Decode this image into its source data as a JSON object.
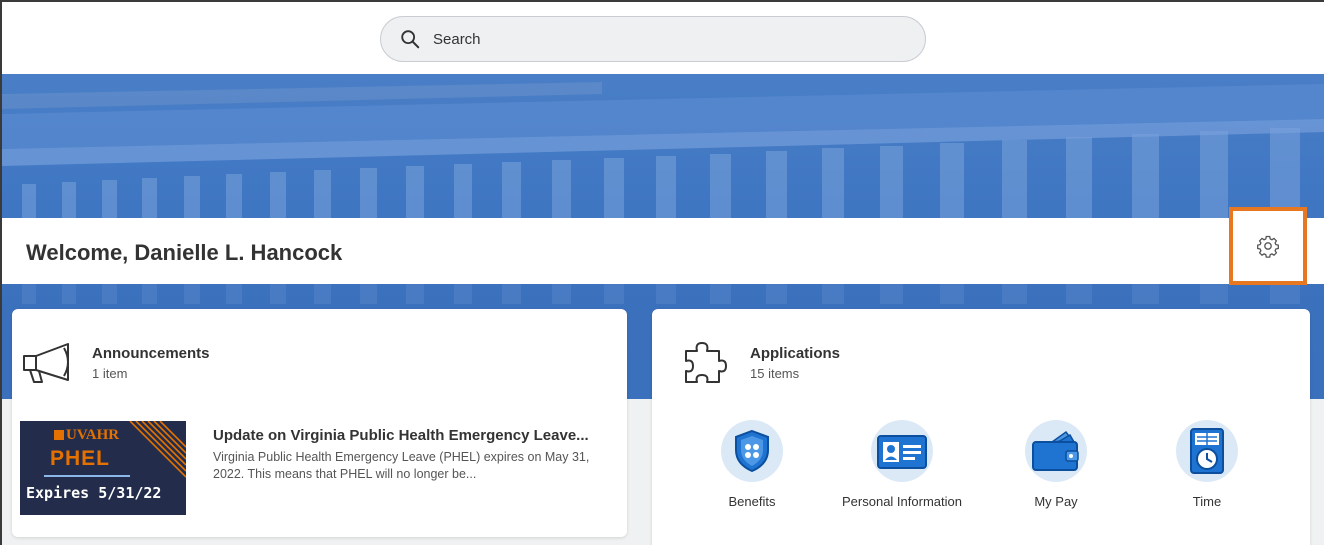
{
  "search": {
    "placeholder": "Search"
  },
  "welcome": {
    "text": "Welcome, Danielle L. Hancock"
  },
  "announcements": {
    "title": "Announcements",
    "count": "1 item",
    "item": {
      "title": "Update on Virginia Public Health Emergency Leave...",
      "body": "Virginia Public Health Emergency Leave (PHEL) expires on May 31, 2022. This means that PHEL will no longer be...",
      "thumb_brand": "UVAHR",
      "thumb_phel": "PHEL",
      "thumb_expires": "Expires 5/31/22"
    }
  },
  "applications": {
    "title": "Applications",
    "count": "15 items",
    "apps": [
      {
        "label": "Benefits",
        "icon": "shield-icon"
      },
      {
        "label": "Personal Information",
        "icon": "id-card-icon"
      },
      {
        "label": "My Pay",
        "icon": "wallet-icon"
      },
      {
        "label": "Time",
        "icon": "clock-icon"
      }
    ]
  },
  "colors": {
    "accent": "#0875e1",
    "highlight": "#e87722",
    "banner": "#3f76c2"
  }
}
